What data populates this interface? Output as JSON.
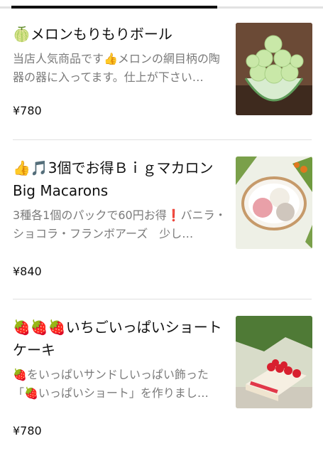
{
  "items": [
    {
      "title": "🍈メロンもりもりボール",
      "description": "当店人気商品です👍メロンの網目柄の陶器の器に入ってます。仕上が下さい…",
      "price": "¥780",
      "image_icon": "melon-dessert-photo"
    },
    {
      "title": "👍🎵3個でお得Ｂｉｇマカロン Big Macarons",
      "description": "3種各1個のパックで60円お得❗バニラ・ショコラ・フランボアーズ　少し…",
      "price": "¥840",
      "image_icon": "macaron-photo"
    },
    {
      "title": "🍓🍓🍓いちごいっぱいショートケーキ",
      "description": "🍓をいっぱいサンドしいっぱい飾った「🍓いっぱいショート」を作りまし…",
      "price": "¥780",
      "image_icon": "strawberry-shortcake-photo"
    }
  ]
}
